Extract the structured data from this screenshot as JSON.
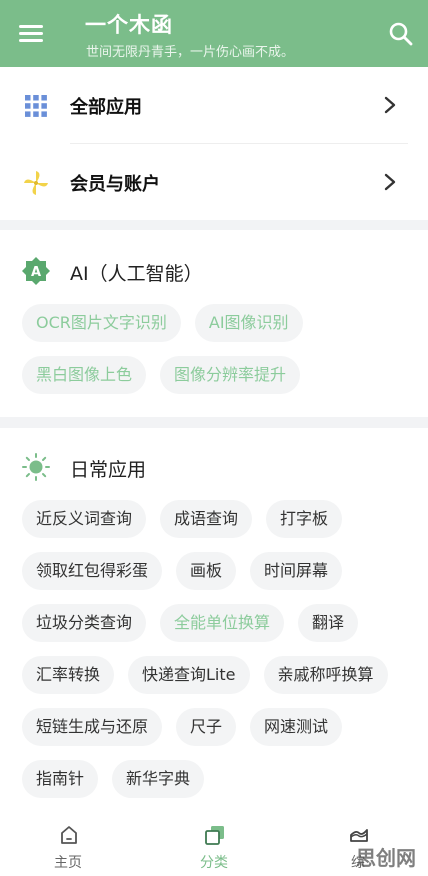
{
  "header": {
    "title": "一个木函",
    "subtitle": "世间无限丹青手，一片伤心画不成。"
  },
  "menu": [
    {
      "label": "全部应用",
      "icon": "grid-icon"
    },
    {
      "label": "会员与账户",
      "icon": "pinwheel-icon"
    }
  ],
  "ai_section": {
    "title": "AI（人工智能）",
    "items": [
      "OCR图片文字识别",
      "AI图像识别",
      "黑白图像上色",
      "图像分辨率提升"
    ]
  },
  "daily_section": {
    "title": "日常应用",
    "items": [
      "近反义词查询",
      "成语查询",
      "打字板",
      "领取红包得彩蛋",
      "画板",
      "时间屏幕",
      "垃圾分类查询",
      "全能单位换算",
      "翻译",
      "汇率转换",
      "快递查询Lite",
      "亲戚称呼换算",
      "短链生成与还原",
      "尺子",
      "网速测试",
      "指南针",
      "新华字典"
    ],
    "highlighted": [
      "全能单位换算"
    ]
  },
  "bottom_nav": {
    "items": [
      {
        "label": "主页",
        "icon": "home-icon"
      },
      {
        "label": "分类",
        "icon": "category-icon",
        "active": true
      },
      {
        "label": "综",
        "icon": "chart-icon"
      }
    ]
  },
  "watermark": "思创网",
  "colors": {
    "primary": "#7bbd8a",
    "chip_bg": "#f3f4f5",
    "chip_highlight_text": "#8ccc9c",
    "pinwheel": "#f2d34a"
  }
}
